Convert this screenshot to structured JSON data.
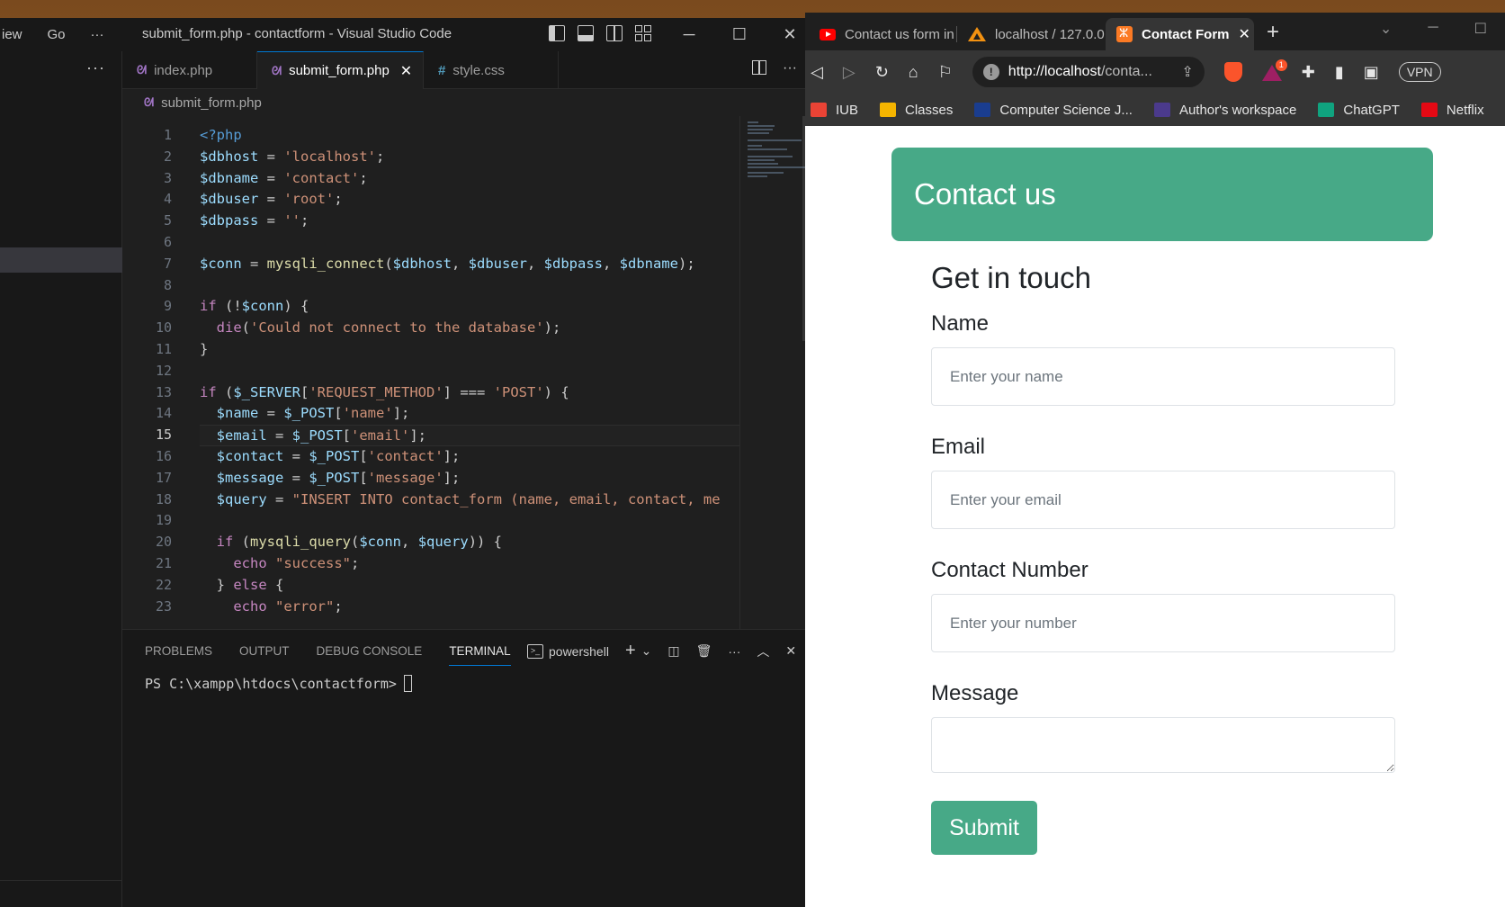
{
  "vscode": {
    "menu": [
      "iew",
      "Go",
      "···"
    ],
    "title": "submit_form.php - contactform - Visual Studio Code",
    "sidebar_more": "···",
    "tabs": [
      {
        "icon": "php-icon",
        "label": "index.php",
        "active": false
      },
      {
        "icon": "php-icon",
        "label": "submit_form.php",
        "active": true
      },
      {
        "icon": "css-icon",
        "label": "style.css",
        "active": false
      }
    ],
    "breadcrumb": "submit_form.php",
    "current_line": 15,
    "line_numbers": [
      "1",
      "2",
      "3",
      "4",
      "5",
      "6",
      "7",
      "8",
      "9",
      "10",
      "11",
      "12",
      "13",
      "14",
      "15",
      "16",
      "17",
      "18",
      "19",
      "20",
      "21",
      "22",
      "23"
    ],
    "code_lines": [
      "<?php",
      "$dbhost = 'localhost';",
      "$dbname = 'contact';",
      "$dbuser = 'root';",
      "$dbpass = '';",
      "",
      "$conn = mysqli_connect($dbhost, $dbuser, $dbpass, $dbname);",
      "",
      "if (!$conn) {",
      "  die('Could not connect to the database');",
      "}",
      "",
      "if ($_SERVER['REQUEST_METHOD'] === 'POST') {",
      "  $name = $_POST['name'];",
      "  $email = $_POST['email'];",
      "  $contact = $_POST['contact'];",
      "  $message = $_POST['message'];",
      "  $query = \"INSERT INTO contact_form (name, email, contact, me",
      "",
      "  if (mysqli_query($conn, $query)) {",
      "    echo \"success\";",
      "  } else {",
      "    echo \"error\";"
    ],
    "panel": {
      "tabs": [
        "PROBLEMS",
        "OUTPUT",
        "DEBUG CONSOLE",
        "TERMINAL"
      ],
      "active_tab": "TERMINAL",
      "shell": "powershell",
      "prompt": "PS C:\\xampp\\htdocs\\contactform>"
    }
  },
  "browser": {
    "tabs": [
      {
        "icon": "youtube-icon",
        "label": "Contact us form in",
        "active": false
      },
      {
        "icon": "phpmyadmin-icon",
        "label": "localhost / 127.0.0.",
        "active": false
      },
      {
        "icon": "xampp-icon",
        "label": "Contact Form",
        "active": true
      }
    ],
    "url_host": "http://localhost",
    "url_rest": "/conta...",
    "vpn": "VPN",
    "bookmarks": [
      {
        "icon": "gmail-icon",
        "label": "IUB",
        "color": "#ea4335"
      },
      {
        "icon": "classes-icon",
        "label": "Classes",
        "color": "#f4b400"
      },
      {
        "icon": "sai-icon",
        "label": "Computer Science J...",
        "color": "#1a3d8f"
      },
      {
        "icon": "author-icon",
        "label": "Author's workspace",
        "color": "#4b3a8c"
      },
      {
        "icon": "chatgpt-icon",
        "label": "ChatGPT",
        "color": "#10a37f"
      },
      {
        "icon": "netflix-icon",
        "label": "Netflix",
        "color": "#e50914"
      }
    ],
    "page": {
      "header": "Contact us",
      "heading": "Get in touch",
      "fields": {
        "name_label": "Name",
        "name_placeholder": "Enter your name",
        "email_label": "Email",
        "email_placeholder": "Enter your email",
        "contact_label": "Contact Number",
        "contact_placeholder": "Enter your number",
        "message_label": "Message"
      },
      "submit_label": "Submit",
      "accent_color": "#47a987"
    }
  }
}
